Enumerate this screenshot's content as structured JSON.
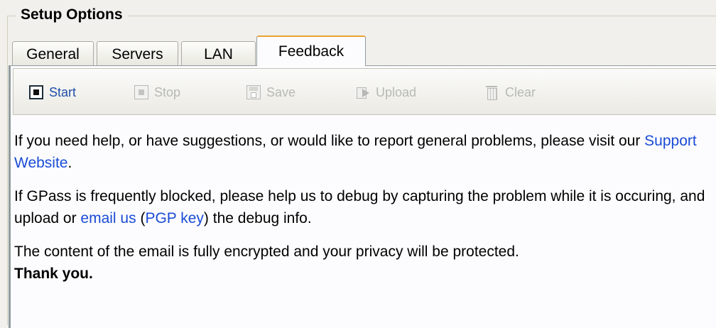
{
  "group": {
    "title": "Setup Options"
  },
  "tabs": [
    {
      "label": "General",
      "active": false
    },
    {
      "label": "Servers",
      "active": false
    },
    {
      "label": "LAN",
      "active": false
    },
    {
      "label": "Feedback",
      "active": true
    }
  ],
  "toolbar": {
    "start": {
      "label": "Start",
      "icon": "record-icon",
      "enabled": true
    },
    "stop": {
      "label": "Stop",
      "icon": "stop-icon",
      "enabled": false
    },
    "save": {
      "label": "Save",
      "icon": "floppy-icon",
      "enabled": false
    },
    "upload": {
      "label": "Upload",
      "icon": "upload-icon",
      "enabled": false
    },
    "clear": {
      "label": "Clear",
      "icon": "trash-icon",
      "enabled": false
    }
  },
  "content": {
    "para1_text_a": "If you need help, or have suggestions, or would like to report general problems, please visit our ",
    "para1_link": "Support Website",
    "para1_text_b": ".",
    "para2_text_a": "If GPass is frequently blocked, please help us to debug by capturing the problem while it is occuring, and upload or ",
    "para2_link_email": "email us",
    "para2_text_b": " (",
    "para2_link_pgp": "PGP key",
    "para2_text_c": ") the debug info.",
    "para3_text": "The content of the email is fully encrypted and your privacy will be protected.",
    "thanks": "Thank you."
  },
  "colors": {
    "link": "#1a4bd6",
    "active_tab_accent": "#e9a232",
    "disabled_text": "#b9b9b4"
  }
}
